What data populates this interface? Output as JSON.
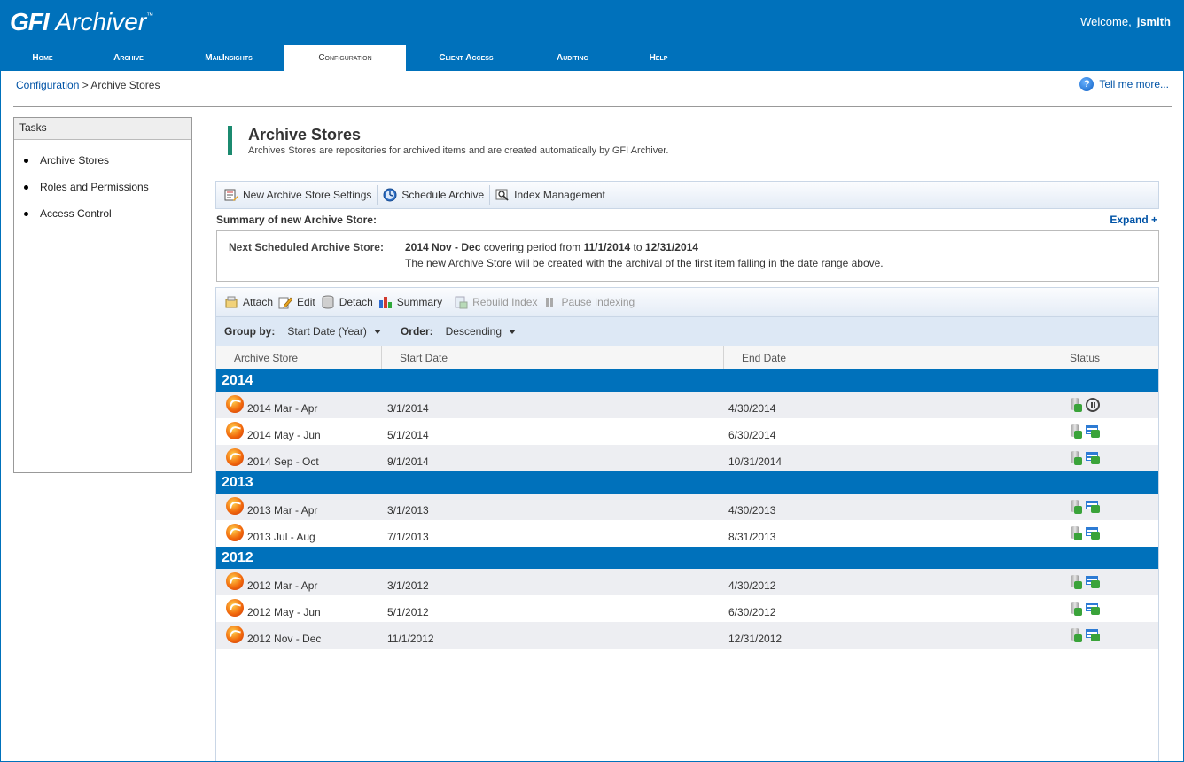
{
  "app": {
    "logo_brand": "GFI",
    "logo_product": "Archiver",
    "logo_tm": "™",
    "welcome_label": "Welcome,",
    "username": "jsmith"
  },
  "nav": {
    "tabs": [
      "Home",
      "Archive",
      "MailInsights",
      "Configuration",
      "Client Access",
      "Auditing",
      "Help"
    ],
    "active": "Configuration"
  },
  "breadcrumb": {
    "parent": "Configuration",
    "separator": ">",
    "current": "Archive Stores"
  },
  "help_link": "Tell me more...",
  "tasks": {
    "title": "Tasks",
    "items": [
      "Archive Stores",
      "Roles and Permissions",
      "Access Control"
    ]
  },
  "page": {
    "title": "Archive Stores",
    "description": "Archives Stores are repositories for archived items and are created automatically by GFI Archiver."
  },
  "toolbar1": {
    "new_store_settings": "New Archive Store Settings",
    "schedule_archive": "Schedule Archive",
    "index_management": "Index Management"
  },
  "summary": {
    "title": "Summary of new Archive Store:",
    "expand": "Expand +",
    "label": "Next Scheduled Archive Store:",
    "store_name": "2014 Nov - Dec",
    "covering_text": "covering period from",
    "from_date": "11/1/2014",
    "to_text": "to",
    "to_date": "12/31/2014",
    "note": "The new Archive Store will be created with the archival of the first item falling in the date range above."
  },
  "toolbar2": {
    "attach": "Attach",
    "edit": "Edit",
    "detach": "Detach",
    "summary": "Summary",
    "rebuild_index": "Rebuild Index",
    "pause_indexing": "Pause Indexing"
  },
  "grouping": {
    "group_by_label": "Group by:",
    "group_by_value": "Start Date (Year)",
    "order_label": "Order:",
    "order_value": "Descending"
  },
  "table": {
    "columns": [
      "Archive Store",
      "Start Date",
      "End Date",
      "Status"
    ],
    "groups": [
      {
        "year": "2014",
        "rows": [
          {
            "name": "2014 Mar - Apr",
            "start": "3/1/2014",
            "end": "4/30/2014",
            "status": "paused"
          },
          {
            "name": "2014 May - Jun",
            "start": "5/1/2014",
            "end": "6/30/2014",
            "status": "indexed"
          },
          {
            "name": "2014 Sep - Oct",
            "start": "9/1/2014",
            "end": "10/31/2014",
            "status": "indexed"
          }
        ]
      },
      {
        "year": "2013",
        "rows": [
          {
            "name": "2013 Mar - Apr",
            "start": "3/1/2013",
            "end": "4/30/2013",
            "status": "indexed"
          },
          {
            "name": "2013 Jul - Aug",
            "start": "7/1/2013",
            "end": "8/31/2013",
            "status": "indexed"
          }
        ]
      },
      {
        "year": "2012",
        "rows": [
          {
            "name": "2012 Mar - Apr",
            "start": "3/1/2012",
            "end": "4/30/2012",
            "status": "indexed"
          },
          {
            "name": "2012 May - Jun",
            "start": "5/1/2012",
            "end": "6/30/2012",
            "status": "indexed"
          },
          {
            "name": "2012 Nov - Dec",
            "start": "11/1/2012",
            "end": "12/31/2012",
            "status": "indexed"
          }
        ]
      }
    ]
  },
  "colors": {
    "brand_blue": "#0071bb",
    "accent_green": "#1b8a6f",
    "link_blue": "#0053a6",
    "row_alt": "#edeef2"
  }
}
